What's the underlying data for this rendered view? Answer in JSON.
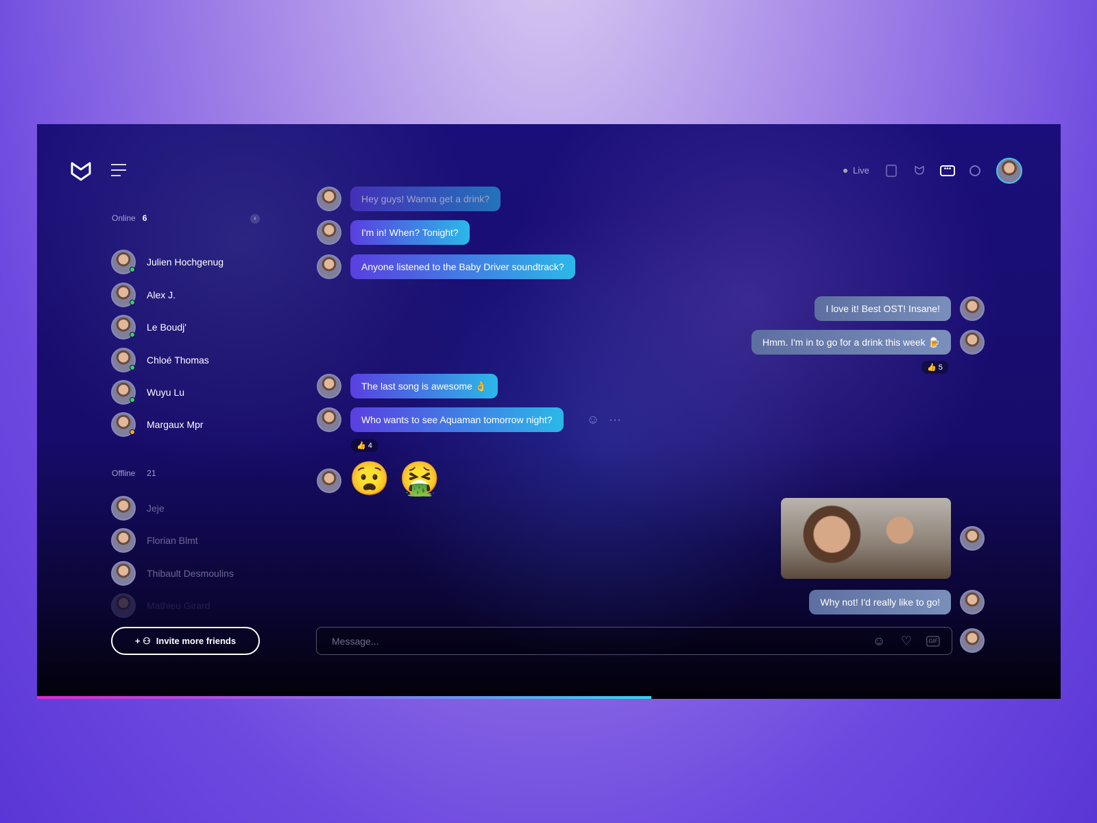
{
  "header": {
    "live_label": "Live"
  },
  "sidebar": {
    "online_label": "Online",
    "online_count": "6",
    "online": [
      {
        "name": "Julien Hochgenug",
        "status": "online"
      },
      {
        "name": "Alex J.",
        "status": "online"
      },
      {
        "name": "Le Boudj'",
        "status": "online"
      },
      {
        "name": "Chloé Thomas",
        "status": "online"
      },
      {
        "name": "Wuyu Lu",
        "status": "online"
      },
      {
        "name": "Margaux Mpr",
        "status": "away"
      }
    ],
    "offline_label": "Offline",
    "offline_count": "21",
    "offline": [
      {
        "name": "Jeje"
      },
      {
        "name": "Florian Blmt"
      },
      {
        "name": "Thibault Desmoulins"
      },
      {
        "name": "Mathieu Girard"
      }
    ],
    "invite_label": "Invite more friends"
  },
  "messages": [
    {
      "side": "left",
      "text": "Hey guys! Wanna get a drink?"
    },
    {
      "side": "left",
      "text": "I'm in! When? Tonight?"
    },
    {
      "side": "left",
      "text": "Anyone listened to the Baby Driver soundtrack?"
    },
    {
      "side": "right",
      "text": "I love it! Best OST! Insane!"
    },
    {
      "side": "right",
      "text": "Hmm. I'm in to go for a drink this week",
      "emoji": "🍺",
      "reaction": "👍 5"
    },
    {
      "side": "left",
      "text": "The last song is awesome",
      "emoji": "👌"
    },
    {
      "side": "left",
      "text": "Who wants to see Aquaman tomorrow night?",
      "reaction": "👍 4"
    },
    {
      "side": "left",
      "emojis": "😧 🤮"
    },
    {
      "side": "right",
      "image": "thumbs-up-gif"
    },
    {
      "side": "right",
      "text": "Why not! I'd really like to go!"
    }
  ],
  "composer": {
    "placeholder": "Message...",
    "gif_label": "GIF"
  },
  "colors": {
    "online": "#2fd65a",
    "away": "#f5a623",
    "accent_start": "#5a3fe0",
    "accent_end": "#2bb8e8"
  },
  "progress": 0.6
}
